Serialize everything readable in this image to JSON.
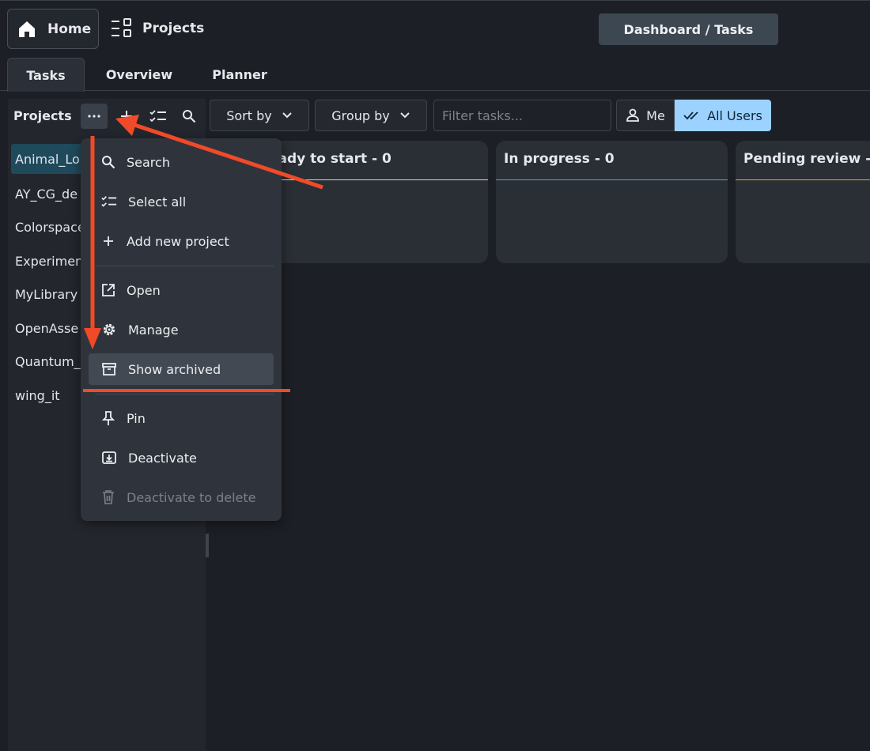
{
  "topbar": {
    "home_label": "Home",
    "projects_label": "Projects",
    "breadcrumb": "Dashboard / Tasks"
  },
  "tabs": [
    {
      "label": "Tasks",
      "active": true
    },
    {
      "label": "Overview",
      "active": false
    },
    {
      "label": "Planner",
      "active": false
    }
  ],
  "sidebar": {
    "title": "Projects",
    "items": [
      "Animal_Lo",
      "AY_CG_de",
      "Colorspace",
      "Experimen",
      "MyLibrary",
      "OpenAsse",
      "Quantum_",
      "wing_it"
    ],
    "selected_index": 0
  },
  "toolbar": {
    "sort_label": "Sort by",
    "group_label": "Group by",
    "filter_placeholder": "Filter tasks...",
    "me_label": "Me",
    "all_users_label": "All Users"
  },
  "columns": [
    {
      "title": "Ready to start - 0",
      "visible_title": "eady to start - 0",
      "accent": "#cfd3da"
    },
    {
      "title": "In progress - 0",
      "accent": "#4aa3df"
    },
    {
      "title": "Pending review - ",
      "accent": "#f0a030"
    }
  ],
  "menu": {
    "items": [
      {
        "label": "Search",
        "icon": "search-icon"
      },
      {
        "label": "Select all",
        "icon": "checklist-icon"
      },
      {
        "label": "Add new project",
        "icon": "plus-icon"
      },
      {
        "label": "Open",
        "icon": "open-external-icon"
      },
      {
        "label": "Manage",
        "icon": "gear-icon"
      },
      {
        "label": "Show archived",
        "icon": "archive-icon",
        "highlighted": true
      },
      {
        "label": "Pin",
        "icon": "pin-icon"
      },
      {
        "label": "Deactivate",
        "icon": "deactivate-icon"
      },
      {
        "label": "Deactivate to delete",
        "icon": "trash-icon",
        "disabled": true
      }
    ]
  },
  "colors": {
    "accent_blue": "#9cd2ff",
    "annotation_red": "#f04a28",
    "selected_project_bg": "#1f4a5c"
  }
}
